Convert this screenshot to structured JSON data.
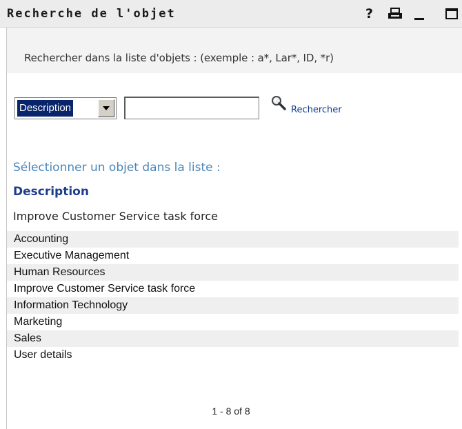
{
  "window": {
    "title": "Recherche de l'objet",
    "help_label": "?",
    "icons": [
      "help-icon",
      "print-icon",
      "minimize-icon",
      "maximize-icon"
    ]
  },
  "hint": {
    "text": "Rechercher dans la liste d'objets : (exemple : a*, Lar*, ID, *r)"
  },
  "search": {
    "attribute_select_value": "Description",
    "input_value": "",
    "button_label": "Rechercher"
  },
  "list": {
    "heading": "Sélectionner un objet dans la liste :",
    "column_header": "Description",
    "selected_value": "Improve Customer Service task force",
    "items": [
      "Accounting",
      "Executive Management",
      "Human Resources",
      "Improve Customer Service task force",
      "Information Technology",
      "Marketing",
      "Sales",
      "User details"
    ],
    "pagination": "1 - 8 of 8"
  },
  "colors": {
    "title_bar": "#ececec",
    "link": "#0a3d8f",
    "heading": "#4a86b8",
    "column_header": "#1c3c8c",
    "row_shade": "#efefef",
    "select_highlight": "#08246b"
  }
}
